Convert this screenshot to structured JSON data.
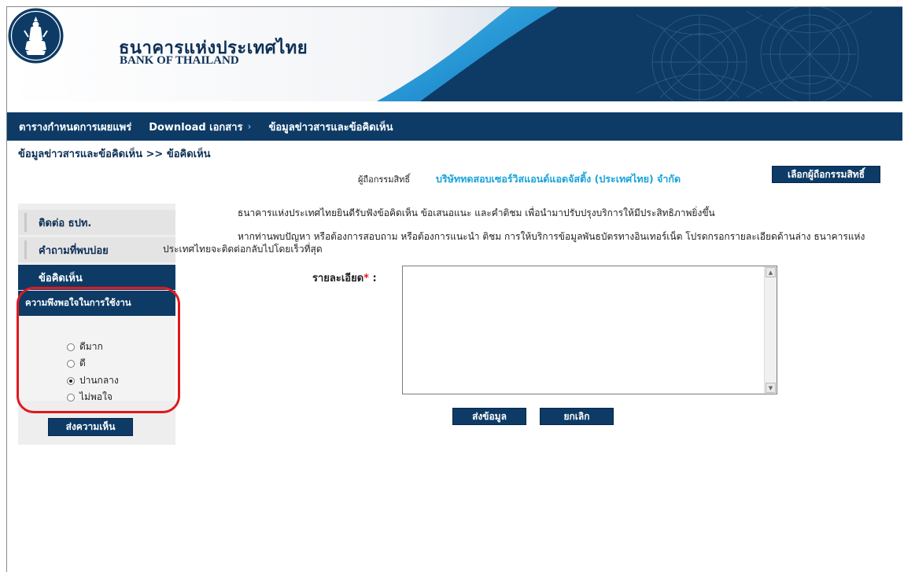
{
  "header": {
    "brand_th": "ธนาคารแห่งประเทศไทย",
    "brand_en": "BANK OF THAILAND",
    "logo_icon": "bank-of-thailand-seal",
    "colors": {
      "banner": "#0d3b66",
      "accent_blue": "#19a3d9",
      "highlight_red": "#e0191f"
    }
  },
  "nav": {
    "items": [
      {
        "label": "ตารางกำหนดการเผยแพร่"
      },
      {
        "label": "Download เอกสาร",
        "chevron": "›"
      },
      {
        "label": "ข้อมูลข่าวสารและข้อคิดเห็น"
      }
    ]
  },
  "breadcrumb": "ข้อมูลข่าวสารและข้อคิดเห็น >> ข้อคิดเห็น",
  "holder": {
    "label": "ผู้ถือกรรมสิทธิ์",
    "value": "บริษัททดสอบเซอร์วิสแอนด์แอดจัสติ้ง (ประเทศไทย) จำกัด",
    "select_button": "เลือกผู้ถือกรรมสิทธิ์"
  },
  "sidebar": {
    "items": [
      {
        "label": "ติดต่อ ธปท."
      },
      {
        "label": "คำถามที่พบบ่อย"
      },
      {
        "label": "ข้อคิดเห็น"
      }
    ],
    "satisfaction": {
      "title": "ความพึงพอใจในการใช้งาน",
      "options": [
        {
          "label": "ดีมาก",
          "checked": false
        },
        {
          "label": "ดี",
          "checked": false
        },
        {
          "label": "ปานกลาง",
          "checked": true
        },
        {
          "label": "ไม่พอใจ",
          "checked": false
        }
      ]
    },
    "send_button": "ส่งความเห็น"
  },
  "main": {
    "intro": "ธนาคารแห่งประเทศไทยยินดีรับฟังข้อคิดเห็น ข้อเสนอแนะ และคำติชม เพื่อนำมาปรับปรุงบริการให้มีประสิทธิภาพยิ่งขึ้น",
    "help": "หากท่านพบปัญหา หรือต้องการสอบถาม หรือต้องการแนะนำ ติชม การให้บริการข้อมูลพันธบัตรทางอินเทอร์เน็ต โปรดกรอกรายละเอียดด้านล่าง ธนาคารแห่งประเทศไทยจะติดต่อกลับไปโดยเร็วที่สุด",
    "detail_label": "รายละเอียด",
    "required_mark": "*",
    "detail_colon": " :",
    "detail_value": "",
    "submit_button": "ส่งข้อมูล",
    "cancel_button": "ยกเลิก"
  }
}
